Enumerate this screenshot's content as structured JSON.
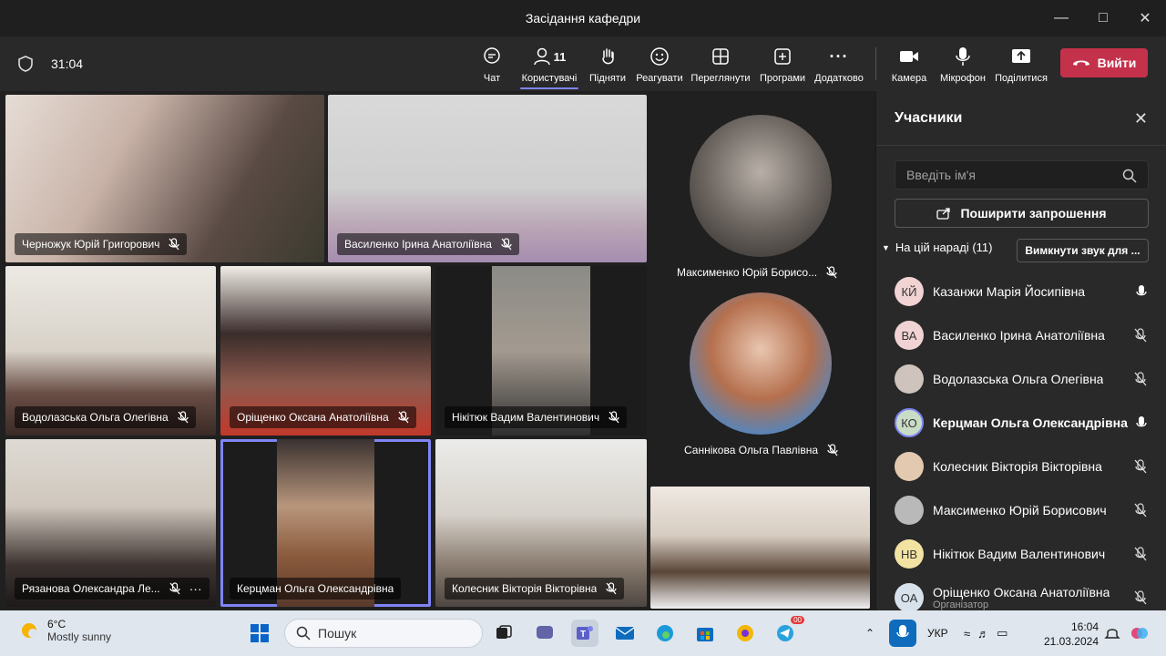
{
  "window": {
    "title": "Засідання кафедри"
  },
  "toolbar": {
    "timer": "31:04",
    "chat": "Чат",
    "people": "Користувачі",
    "people_count": "11",
    "raise": "Підняти",
    "react": "Реагувати",
    "view": "Переглянути",
    "apps": "Програми",
    "more": "Додатково",
    "camera": "Камера",
    "mic": "Мікрофон",
    "share": "Поділитися",
    "leave": "Вийти"
  },
  "tiles": [
    {
      "name": "Черножук Юрій Григорович"
    },
    {
      "name": "Василенко Ірина Анатоліївна"
    },
    {
      "name": "Водолазська Ольга Олегівна"
    },
    {
      "name": "Оріщенко Оксана Анатоліївна"
    },
    {
      "name": "Нікітюк Вадим Валентинович"
    },
    {
      "name": "Рязанова Олександра Ле..."
    },
    {
      "name": "Керцман Ольга Олександрівна"
    },
    {
      "name": "Колесник Вікторія Вікторівна"
    }
  ],
  "side_tiles": [
    {
      "name": "Максименко Юрій Борисо..."
    },
    {
      "name": "Саннікова Ольга Павлівна"
    }
  ],
  "panel": {
    "title": "Учасники",
    "search_placeholder": "Введіть ім'я",
    "share_invite": "Поширити запрошення",
    "section": "На цій нараді (11)",
    "mute_all": "Вимкнути звук для ...",
    "participants": [
      {
        "initials": "КЙ",
        "name": "Казанжи Марія Йосипівна",
        "avatar_color": "#f1d3d3",
        "mic": "on",
        "sub": ""
      },
      {
        "initials": "ВА",
        "name": "Василенко Ірина Анатоліївна",
        "avatar_color": "#f1d3d3",
        "mic": "off",
        "sub": ""
      },
      {
        "initials": "",
        "name": "Водолазська Ольга Олегівна",
        "avatar_color": "#cfc4bd",
        "mic": "off",
        "sub": ""
      },
      {
        "initials": "КО",
        "name": "Керцман Ольга Олександрівна",
        "avatar_color": "#c9ddc6",
        "mic": "on",
        "sub": ""
      },
      {
        "initials": "",
        "name": "Колесник Вікторія Вікторівна",
        "avatar_color": "#e2c9b0",
        "mic": "off",
        "sub": ""
      },
      {
        "initials": "",
        "name": "Максименко Юрій Борисович",
        "avatar_color": "#b9b9b9",
        "mic": "off",
        "sub": ""
      },
      {
        "initials": "НВ",
        "name": "Нікітюк Вадим Валентинович",
        "avatar_color": "#f3e3a3",
        "mic": "off",
        "sub": ""
      },
      {
        "initials": "ОА",
        "name": "Оріщенко Оксана Анатоліївна",
        "avatar_color": "#d8e2ec",
        "mic": "off",
        "sub": "Організатор"
      }
    ]
  },
  "taskbar": {
    "temp": "6°C",
    "weather": "Mostly sunny",
    "search": "Пошук",
    "lang": "УКР",
    "time": "16:04",
    "date": "21.03.2024",
    "badge": "00"
  }
}
